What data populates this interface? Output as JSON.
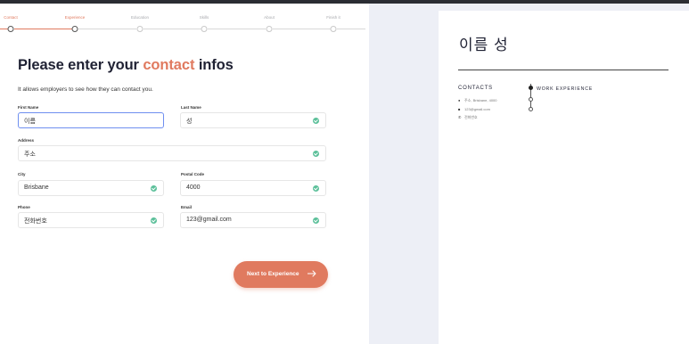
{
  "steps": [
    {
      "label": "Contact",
      "active": true
    },
    {
      "label": "Experience",
      "active": true
    },
    {
      "label": "Education",
      "active": false
    },
    {
      "label": "Skills",
      "active": false
    },
    {
      "label": "About",
      "active": false
    },
    {
      "label": "Finish it",
      "active": false
    }
  ],
  "form": {
    "title_pre": "Please enter your ",
    "title_accent": "contact",
    "title_post": " infos",
    "subtitle": "It allows employers to see how they can contact you.",
    "fields": {
      "first_name": {
        "label": "First Name",
        "value": "이름"
      },
      "last_name": {
        "label": "Last Name",
        "value": "성"
      },
      "address": {
        "label": "Address",
        "value": "주소"
      },
      "city": {
        "label": "City",
        "value": "Brisbane"
      },
      "postal_code": {
        "label": "Postal Code",
        "value": "4000"
      },
      "phone": {
        "label": "Phone",
        "value": "전화번호"
      },
      "email": {
        "label": "Email",
        "value": "123@gmail.com"
      }
    },
    "next_label": "Next to Experience"
  },
  "preview": {
    "name": "이름 성",
    "contacts_title": "CONTACTS",
    "work_title": "WORK EXPERIENCE",
    "contacts": [
      {
        "icon": "location-pin-icon",
        "text": "주소, Brisbane, 4000"
      },
      {
        "icon": "mail-icon",
        "text": "123@gmail.com"
      },
      {
        "icon": "phone-icon",
        "text": "전화번호"
      }
    ]
  },
  "colors": {
    "accent": "#e07a5f",
    "success": "#5cc09a",
    "focus": "#6f8ff0",
    "preview_bg": "#edeff6"
  }
}
